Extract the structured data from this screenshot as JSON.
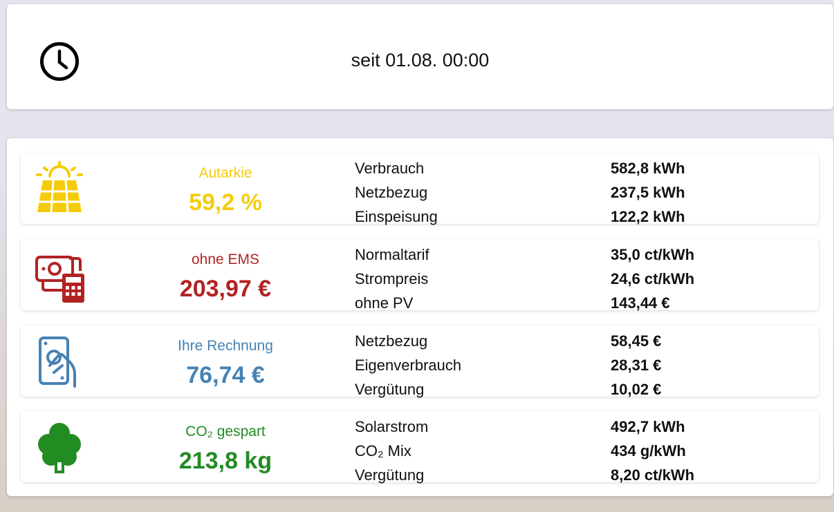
{
  "header": {
    "since_label": "seit 01.08. 00:00"
  },
  "stats": [
    {
      "icon": "solar-panel-icon",
      "color": "#f5cc0b",
      "label": "Autarkie",
      "value": "59,2 %",
      "rows": [
        {
          "k": "Verbrauch",
          "v": "582,8 kWh"
        },
        {
          "k": "Netzbezug",
          "v": "237,5 kWh"
        },
        {
          "k": "Einspeisung",
          "v": "122,2 kWh"
        }
      ]
    },
    {
      "icon": "money-calculator-icon",
      "color": "#b22222",
      "label": "ohne EMS",
      "value": "203,97 €",
      "rows": [
        {
          "k": "Normaltarif",
          "v": "35,0 ct/kWh"
        },
        {
          "k": "Strompreis",
          "v": "24,6 ct/kWh"
        },
        {
          "k": "ohne PV",
          "v": "143,44 €"
        }
      ]
    },
    {
      "icon": "hand-holding-bill-icon",
      "color": "#4682b4",
      "label": "Ihre Rechnung",
      "value": "76,74 €",
      "rows": [
        {
          "k": "Netzbezug",
          "v": "58,45 €"
        },
        {
          "k": "Eigenverbrauch",
          "v": "28,31 €"
        },
        {
          "k": "Vergütung",
          "v": "10,02 €"
        }
      ]
    },
    {
      "icon": "tree-icon",
      "color": "#228b22",
      "label": "CO₂ gespart",
      "value": "213,8 kg",
      "rows": [
        {
          "k": "Solarstrom",
          "v": "492,7 kWh"
        },
        {
          "k": "CO₂ Mix",
          "v": "434 g/kWh"
        },
        {
          "k": "Vergütung",
          "v": "8,20 ct/kWh"
        }
      ]
    }
  ]
}
